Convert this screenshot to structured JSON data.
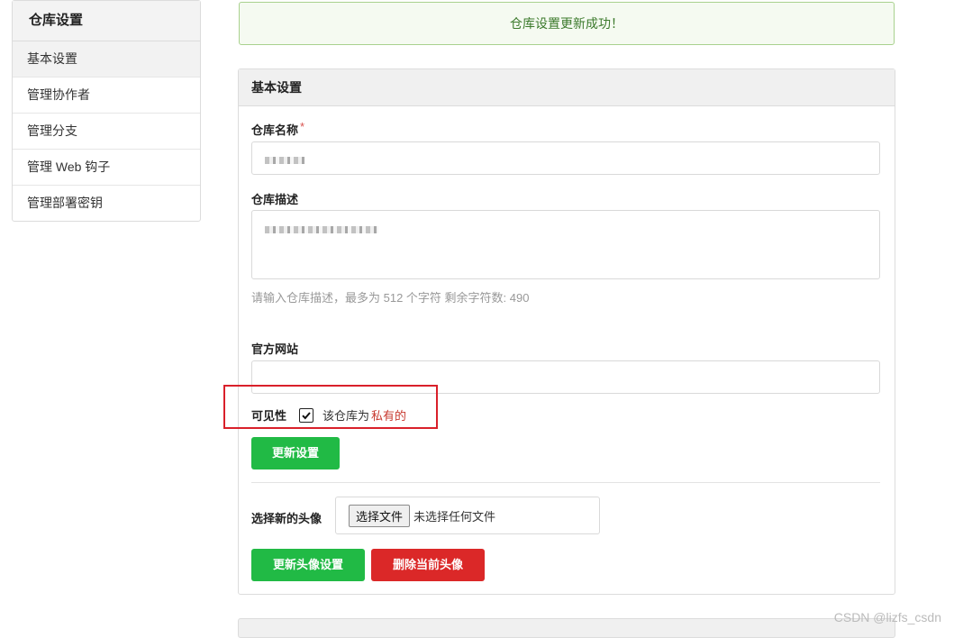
{
  "sidebar": {
    "title": "仓库设置",
    "items": [
      {
        "label": "基本设置",
        "active": true
      },
      {
        "label": "管理协作者"
      },
      {
        "label": "管理分支"
      },
      {
        "label": "管理 Web 钩子"
      },
      {
        "label": "管理部署密钥"
      }
    ]
  },
  "banner": {
    "text": "仓库设置更新成功！"
  },
  "panel": {
    "title": "基本设置",
    "repo_name": {
      "label": "仓库名称",
      "required_mark": "*"
    },
    "repo_desc": {
      "label": "仓库描述",
      "hint": "请输入仓库描述，最多为 512 个字符 剩余字符数: 490"
    },
    "website": {
      "label": "官方网站",
      "value": ""
    },
    "visibility": {
      "label": "可见性",
      "checked": true,
      "text": "该仓库为",
      "value": "私有的"
    },
    "update_button": "更新设置",
    "avatar": {
      "label": "选择新的头像",
      "file_button": "选择文件",
      "file_status": "未选择任何文件"
    },
    "update_avatar_button": "更新头像设置",
    "delete_avatar_button": "删除当前头像"
  },
  "watermark": "CSDN @lizfs_csdn",
  "colors": {
    "success_green": "#21ba45",
    "danger_red": "#db2828",
    "private_red": "#c7392f"
  }
}
